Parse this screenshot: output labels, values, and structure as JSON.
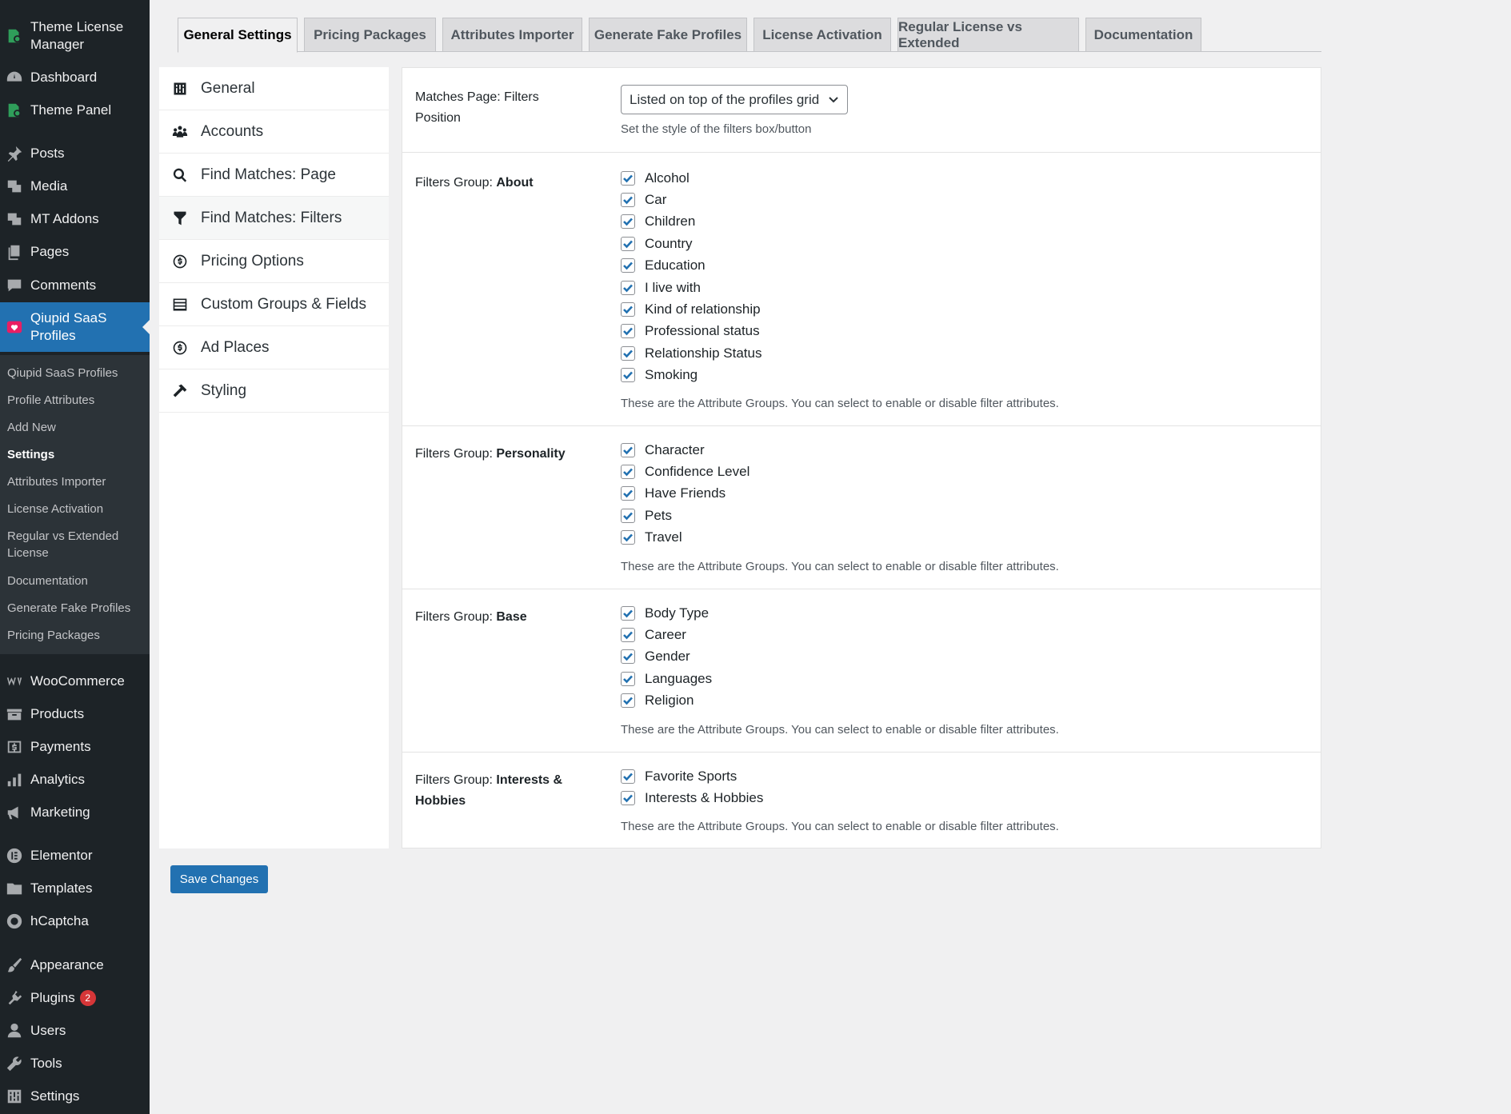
{
  "sidebar": {
    "items": [
      {
        "label": "Theme License Manager",
        "icon": "theme-license-icon"
      },
      {
        "label": "Dashboard",
        "icon": "dashboard-icon"
      },
      {
        "label": "Theme Panel",
        "icon": "theme-panel-icon"
      },
      {
        "label": "Posts",
        "icon": "pin-icon"
      },
      {
        "label": "Media",
        "icon": "media-icon"
      },
      {
        "label": "MT Addons",
        "icon": "addons-icon"
      },
      {
        "label": "Pages",
        "icon": "pages-icon"
      },
      {
        "label": "Comments",
        "icon": "comments-icon"
      },
      {
        "label": "Qiupid SaaS Profiles",
        "icon": "heart-icon"
      },
      {
        "label": "WooCommerce",
        "icon": "woocommerce-icon"
      },
      {
        "label": "Products",
        "icon": "products-icon"
      },
      {
        "label": "Payments",
        "icon": "payments-icon"
      },
      {
        "label": "Analytics",
        "icon": "analytics-icon"
      },
      {
        "label": "Marketing",
        "icon": "megaphone-icon"
      },
      {
        "label": "Elementor",
        "icon": "elementor-icon"
      },
      {
        "label": "Templates",
        "icon": "folder-icon"
      },
      {
        "label": "hCaptcha",
        "icon": "hcaptcha-icon"
      },
      {
        "label": "Appearance",
        "icon": "brush-icon"
      },
      {
        "label": "Plugins",
        "icon": "plugin-icon",
        "badge": "2"
      },
      {
        "label": "Users",
        "icon": "users-icon"
      },
      {
        "label": "Tools",
        "icon": "wrench-icon"
      },
      {
        "label": "Settings",
        "icon": "settings-icon"
      }
    ],
    "submenu": [
      "Qiupid SaaS Profiles",
      "Profile Attributes",
      "Add New",
      "Settings",
      "Attributes Importer",
      "License Activation",
      "Regular vs Extended License",
      "Documentation",
      "Generate Fake Profiles",
      "Pricing Packages"
    ],
    "active_submenu": "Settings"
  },
  "tabs": [
    "General Settings",
    "Pricing Packages",
    "Attributes Importer",
    "Generate Fake Profiles",
    "License Activation",
    "Regular License vs Extended",
    "Documentation"
  ],
  "settings_nav": [
    {
      "label": "General",
      "icon": "general-icon"
    },
    {
      "label": "Accounts",
      "icon": "accounts-icon"
    },
    {
      "label": "Find Matches: Page",
      "icon": "search-icon"
    },
    {
      "label": "Find Matches: Filters",
      "icon": "filter-icon"
    },
    {
      "label": "Pricing Options",
      "icon": "dollar-icon"
    },
    {
      "label": "Custom Groups & Fields",
      "icon": "list-icon"
    },
    {
      "label": "Ad Places",
      "icon": "dollar-icon"
    },
    {
      "label": "Styling",
      "icon": "hammer-icon"
    }
  ],
  "main": {
    "filters_position": {
      "label": "Matches Page: Filters Position",
      "value": "Listed on top of the profiles grid",
      "description": "Set the style of the filters box/button"
    },
    "group_label_prefix": "Filters Group:",
    "group_description": "These are the Attribute Groups. You can select to enable or disable filter attributes.",
    "groups": [
      {
        "name": "About",
        "items": [
          "Alcohol",
          "Car",
          "Children",
          "Country",
          "Education",
          "I live with",
          "Kind of relationship",
          "Professional status",
          "Relationship Status",
          "Smoking"
        ]
      },
      {
        "name": "Personality",
        "items": [
          "Character",
          "Confidence Level",
          "Have Friends",
          "Pets",
          "Travel"
        ]
      },
      {
        "name": "Base",
        "items": [
          "Body Type",
          "Career",
          "Gender",
          "Languages",
          "Religion"
        ]
      },
      {
        "name": "Interests & Hobbies",
        "items": [
          "Favorite Sports",
          "Interests & Hobbies"
        ]
      }
    ]
  },
  "save_label": "Save Changes",
  "colors": {
    "accent": "#2271b1",
    "sidebar_bg": "#1d2327",
    "current_menu_icon": "#e91e63",
    "badge": "#d63638"
  }
}
